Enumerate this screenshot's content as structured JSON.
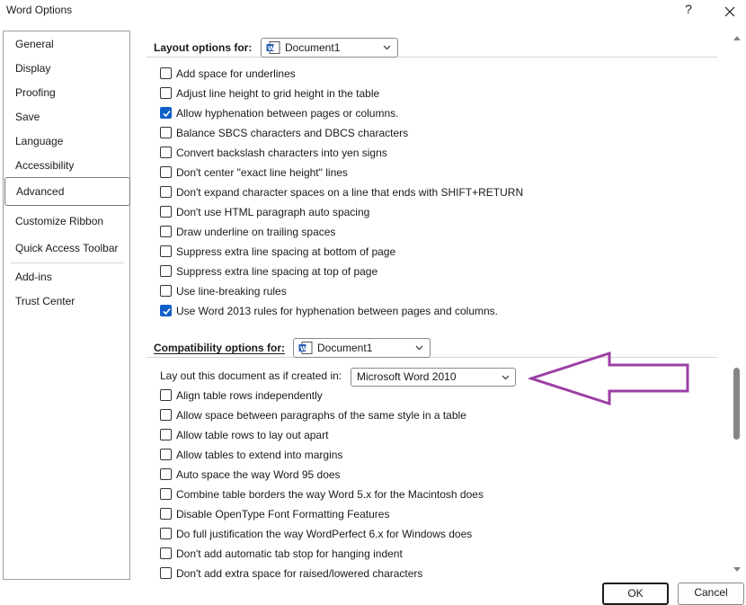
{
  "window": {
    "title": "Word Options",
    "help_label": "?"
  },
  "sidebar": {
    "items": [
      {
        "label": "General"
      },
      {
        "label": "Display"
      },
      {
        "label": "Proofing"
      },
      {
        "label": "Save"
      },
      {
        "label": "Language"
      },
      {
        "label": "Accessibility"
      },
      {
        "label": "Advanced",
        "selected": true
      },
      {
        "label": "Customize Ribbon"
      },
      {
        "label": "Quick Access Toolbar"
      },
      {
        "label": "Add-ins"
      },
      {
        "label": "Trust Center"
      }
    ]
  },
  "layout_section": {
    "label": "Layout options for:",
    "document": "Document1",
    "options": [
      {
        "label": "Add space for underlines",
        "checked": false
      },
      {
        "label": "Adjust line height to grid height in the table",
        "checked": false
      },
      {
        "label": "Allow hyphenation between pages or columns.",
        "checked": true
      },
      {
        "label": "Balance SBCS characters and DBCS characters",
        "checked": false
      },
      {
        "label": "Convert backslash characters into yen signs",
        "checked": false
      },
      {
        "label": "Don't center \"exact line height\" lines",
        "checked": false
      },
      {
        "label": "Don't expand character spaces on a line that ends with SHIFT+RETURN",
        "checked": false
      },
      {
        "label": "Don't use HTML paragraph auto spacing",
        "checked": false
      },
      {
        "label": "Draw underline on trailing spaces",
        "checked": false
      },
      {
        "label": "Suppress extra line spacing at bottom of page",
        "checked": false
      },
      {
        "label": "Suppress extra line spacing at top of page",
        "checked": false
      },
      {
        "label": "Use line-breaking rules",
        "checked": false
      },
      {
        "label": "Use Word 2013 rules for hyphenation between pages and columns.",
        "checked": true
      }
    ]
  },
  "compat_section": {
    "label": "Compatibility options for:",
    "document": "Document1",
    "layout_as_label": "Lay out this document as if created in:",
    "layout_as_value": "Microsoft Word 2010",
    "options": [
      {
        "label": "Align table rows independently",
        "checked": false
      },
      {
        "label": "Allow space between paragraphs of the same style in a table",
        "checked": false
      },
      {
        "label": "Allow table rows to lay out apart",
        "checked": false
      },
      {
        "label": "Allow tables to extend into margins",
        "checked": false
      },
      {
        "label": "Auto space the way Word 95 does",
        "checked": false
      },
      {
        "label": "Combine table borders the way Word 5.x for the Macintosh does",
        "checked": false
      },
      {
        "label": "Disable OpenType Font Formatting Features",
        "checked": false
      },
      {
        "label": "Do full justification the way WordPerfect 6.x for Windows does",
        "checked": false
      },
      {
        "label": "Don't add automatic tab stop for hanging indent",
        "checked": false
      },
      {
        "label": "Don't add extra space for raised/lowered characters",
        "checked": false
      }
    ]
  },
  "footer": {
    "ok_label": "OK",
    "cancel_label": "Cancel"
  },
  "colors": {
    "checkbox_checked": "#1060c8",
    "annotation_arrow": "#9b3fa6"
  }
}
